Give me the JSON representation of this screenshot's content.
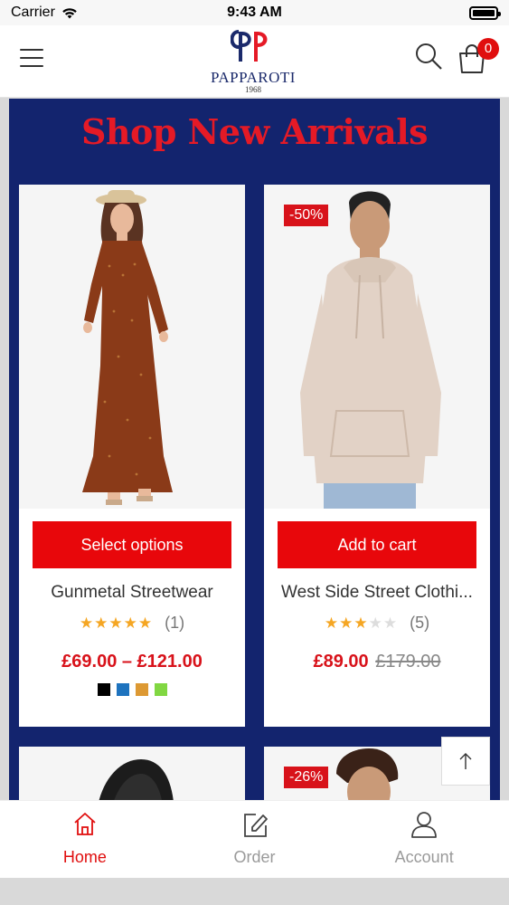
{
  "status_bar": {
    "carrier": "Carrier",
    "time": "9:43 AM"
  },
  "header": {
    "logo_name": "PAPPAROTI",
    "logo_year": "1968",
    "cart_count": "0"
  },
  "section": {
    "title": "Shop New Arrivals"
  },
  "products": [
    {
      "name": "Gunmetal Streetwear",
      "button": "Select options",
      "rating_count": "(1)",
      "stars": 5,
      "price": "£69.00 – £121.00",
      "swatches": [
        "#000000",
        "#1e73be",
        "#dd9933",
        "#81d742"
      ]
    },
    {
      "name": "West Side Street Clothi...",
      "button": "Add to cart",
      "rating_count": "(5)",
      "stars": 3,
      "discount": "-50%",
      "price": "£89.00",
      "old_price": "£179.00"
    }
  ],
  "second_row": {
    "discount": "-26%"
  },
  "bottom_nav": [
    {
      "label": "Home",
      "icon": "home-icon",
      "active": true
    },
    {
      "label": "Order",
      "icon": "edit-icon",
      "active": false
    },
    {
      "label": "Account",
      "icon": "user-icon",
      "active": false
    }
  ],
  "colors": {
    "accent": "#e00e0e",
    "navy": "#13246e",
    "star": "#f5a623"
  }
}
